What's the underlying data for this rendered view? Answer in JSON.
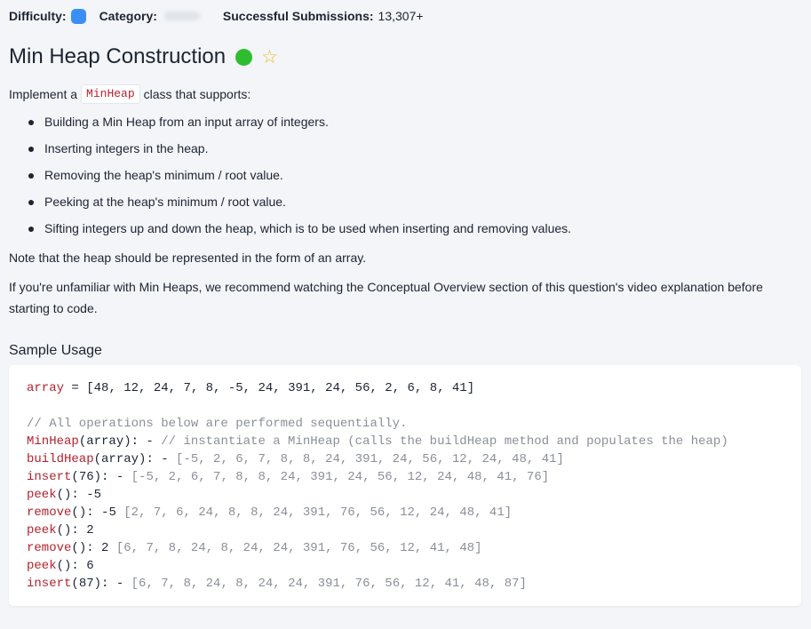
{
  "meta": {
    "difficulty_label": "Difficulty:",
    "category_label": "Category:",
    "submissions_label": "Successful Submissions:",
    "submissions_value": "13,307+"
  },
  "title": "Min Heap Construction",
  "colors": {
    "difficulty_badge": "#3a8ef6",
    "status_dot": "#2fbd2f",
    "star": "#f1b92a",
    "code_red": "#b5222d",
    "code_gray": "#8a8f98"
  },
  "icons": {
    "status": "solved-status-icon",
    "favorite": "star-outline-icon"
  },
  "intro": {
    "prefix": "Implement a",
    "code": "MinHeap",
    "suffix": "class that supports:"
  },
  "bullets": [
    "Building a Min Heap from an input array of integers.",
    "Inserting integers in the heap.",
    "Removing the heap's minimum / root value.",
    "Peeking at the heap's minimum / root value.",
    "Sifting integers up and down the heap, which is to be used when inserting and removing values."
  ],
  "note": "Note that the heap should be represented in the form of an array.",
  "paragraph": "If you're unfamiliar with Min Heaps, we recommend watching the Conceptual Overview section of this question's video explanation before starting to code.",
  "sample_title": "Sample Usage",
  "code": {
    "line1": {
      "var": "array",
      "op": " = ",
      "val": "[48, 12, 24, 7, 8, -5, 24, 391, 24, 56, 2, 6, 8, 41]"
    },
    "comment": "// All operations below are performed sequentially.",
    "ops": [
      {
        "call": "MinHeap",
        "args": "(array)",
        "sep": ": - ",
        "result": "",
        "gray": "// instantiate a MinHeap (calls the buildHeap method and populates the heap)"
      },
      {
        "call": "buildHeap",
        "args": "(array)",
        "sep": ": - ",
        "result": "",
        "gray": "[-5, 2, 6, 7, 8, 8, 24, 391, 24, 56, 12, 24, 48, 41]"
      },
      {
        "call": "insert",
        "args": "(76)",
        "sep": ": - ",
        "result": "",
        "gray": "[-5, 2, 6, 7, 8, 8, 24, 391, 24, 56, 12, 24, 48, 41, 76]"
      },
      {
        "call": "peek",
        "args": "()",
        "sep": ": ",
        "result": "-5",
        "gray": ""
      },
      {
        "call": "remove",
        "args": "()",
        "sep": ": ",
        "result": "-5 ",
        "gray": "[2, 7, 6, 24, 8, 8, 24, 391, 76, 56, 12, 24, 48, 41]"
      },
      {
        "call": "peek",
        "args": "()",
        "sep": ": ",
        "result": "2",
        "gray": ""
      },
      {
        "call": "remove",
        "args": "()",
        "sep": ": ",
        "result": "2 ",
        "gray": "[6, 7, 8, 24, 8, 24, 24, 391, 76, 56, 12, 41, 48]"
      },
      {
        "call": "peek",
        "args": "()",
        "sep": ": ",
        "result": "6",
        "gray": ""
      },
      {
        "call": "insert",
        "args": "(87)",
        "sep": ": - ",
        "result": "",
        "gray": "[6, 7, 8, 24, 8, 24, 24, 391, 76, 56, 12, 41, 48, 87]"
      }
    ]
  }
}
